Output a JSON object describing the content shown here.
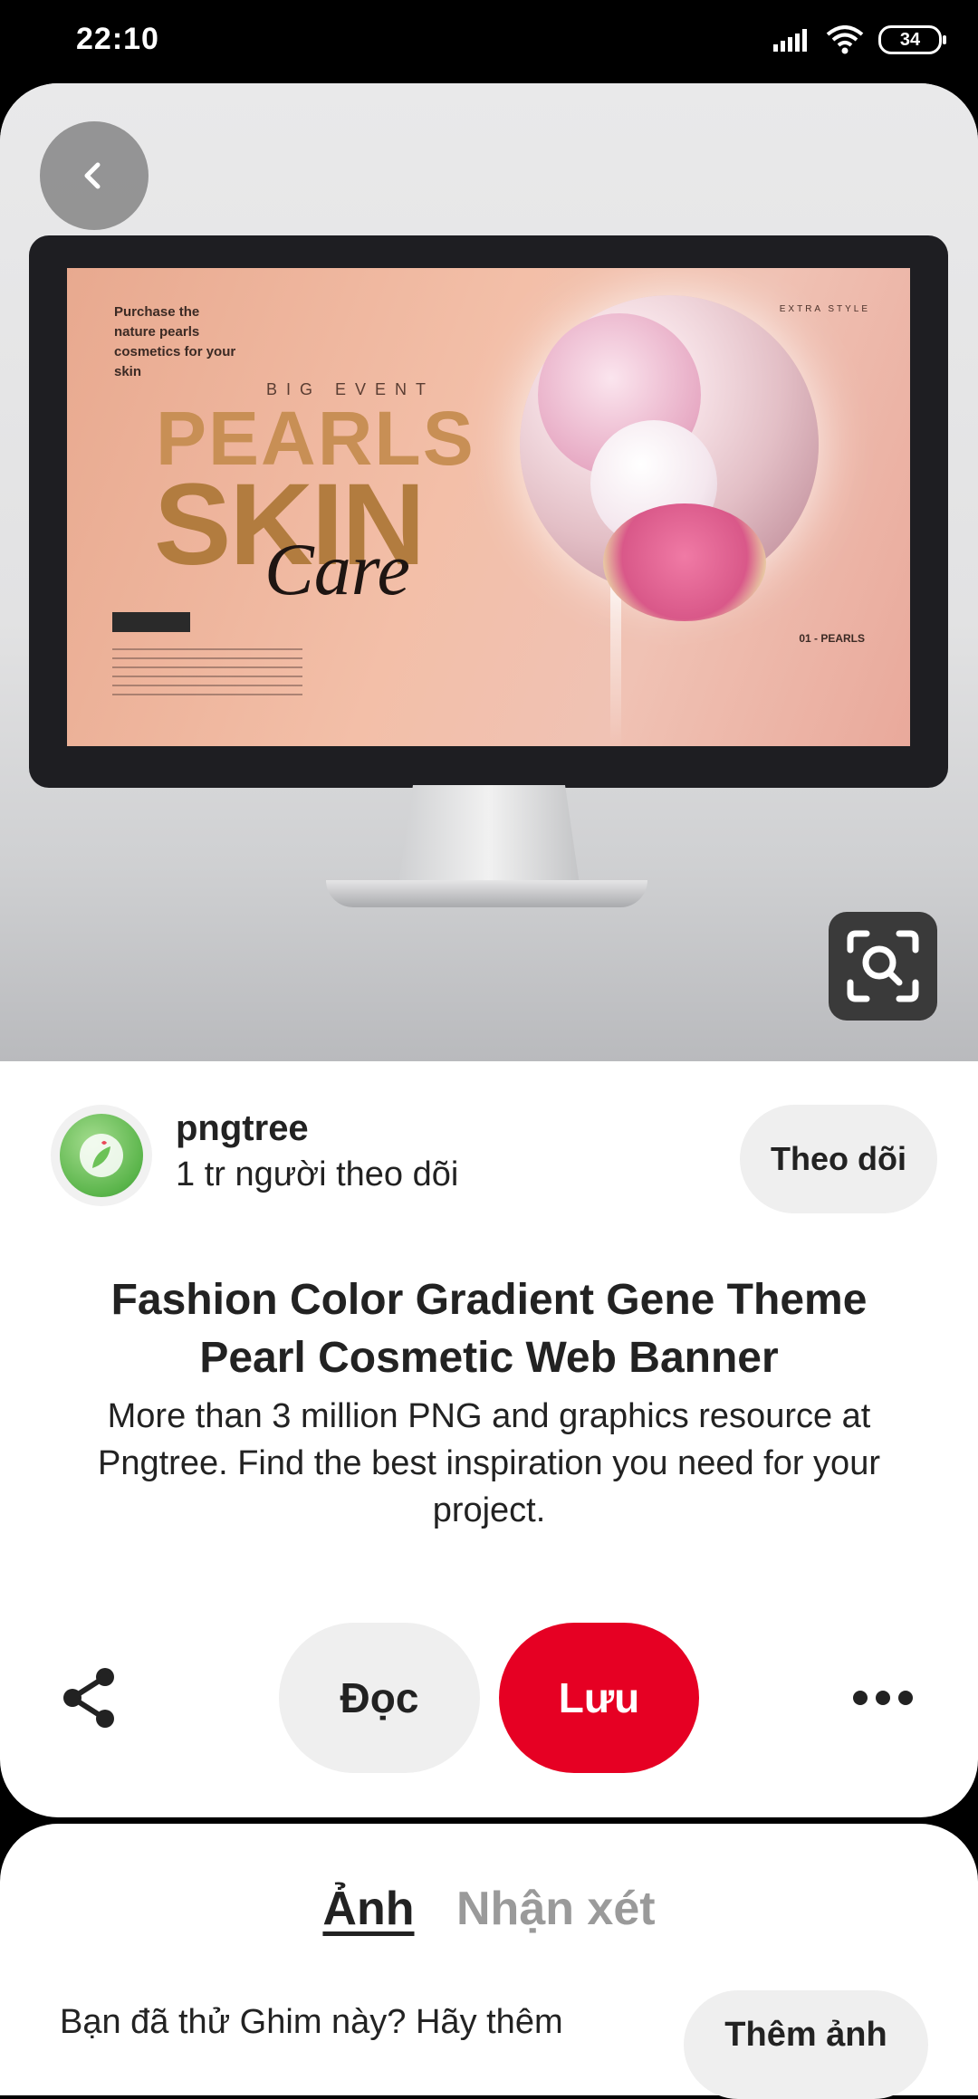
{
  "status_bar": {
    "time": "22:10",
    "battery": "34",
    "icons": [
      "signal-icon",
      "wifi-icon",
      "battery-icon"
    ]
  },
  "pin_image": {
    "banner": {
      "tagline": "Purchase the nature pearls cosmetics for your skin",
      "event": "BIG EVENT",
      "headline_1": "PEARLS",
      "headline_2": "SKIN",
      "headline_3": "Care",
      "top_right": "EXTRA STYLE",
      "bottom_right": "01 - PEARLS"
    }
  },
  "creator": {
    "name": "pngtree",
    "followers": "1 tr người theo dõi",
    "follow_label": "Theo dõi"
  },
  "pin": {
    "title": "Fashion Color Gradient Gene Theme Pearl Cosmetic Web Banner",
    "description": "More than 3 million PNG and graphics resource at Pngtree. Find the best inspiration you need for your project."
  },
  "actions": {
    "read_label": "Đọc",
    "save_label": "Lưu",
    "save_color": "#e60023"
  },
  "bottom": {
    "tab_photo": "Ảnh",
    "tab_comments": "Nhận xét",
    "prompt": "Bạn đã thử Ghim này? Hãy thêm",
    "add_photo_label": "Thêm ảnh"
  }
}
